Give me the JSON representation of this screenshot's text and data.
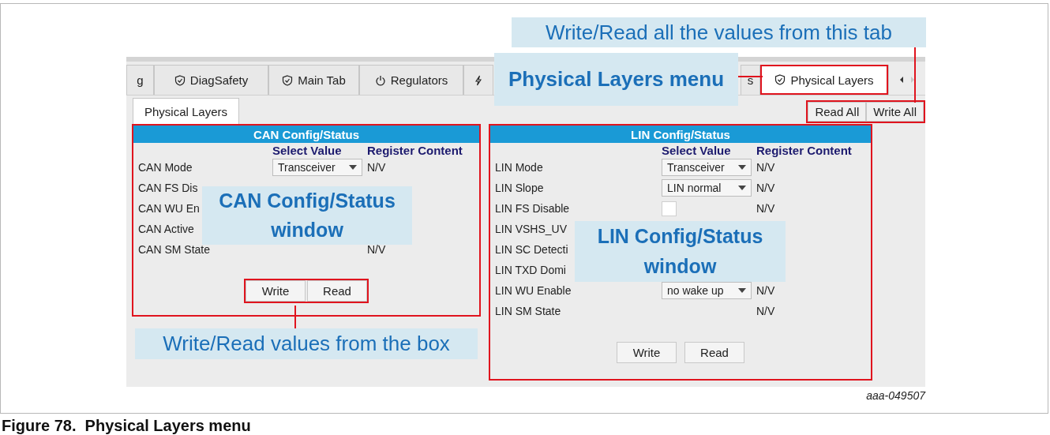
{
  "callouts": {
    "tab": "Write/Read all the values from this tab",
    "menu": "Physical Layers menu",
    "can": "CAN Config/Status window",
    "lin": "LIN Config/Status window",
    "box": "Write/Read values from the box"
  },
  "tabs": [
    {
      "label": "g",
      "selected": false
    },
    {
      "label": "DiagSafety",
      "selected": false
    },
    {
      "label": "Main Tab",
      "selected": false
    },
    {
      "label": "Regulators",
      "selected": false
    },
    {
      "selected": false
    },
    {
      "label": "s",
      "selected": false
    },
    {
      "label": "Physical Layers",
      "selected": true
    }
  ],
  "subtabs": [
    {
      "label": "Physical Layers"
    }
  ],
  "global_buttons": [
    "Read All",
    "Write All"
  ],
  "panels": [
    {
      "title": "CAN Config/Status",
      "columns": [
        "Select Value",
        "Register Content"
      ],
      "rows": [
        {
          "label": "CAN Mode",
          "kind": "select",
          "value": "Transceiver",
          "register": "N/V"
        },
        {
          "label": "CAN FS Dis",
          "kind": "none"
        },
        {
          "label": "CAN WU En",
          "kind": "none"
        },
        {
          "label": "CAN Active",
          "kind": "none"
        },
        {
          "label": "CAN SM State",
          "kind": "none",
          "register": "N/V"
        }
      ],
      "buttons": [
        "Write",
        "Read"
      ]
    },
    {
      "title": "LIN Config/Status",
      "columns": [
        "Select Value",
        "Register Content"
      ],
      "rows": [
        {
          "label": "LIN Mode",
          "kind": "select",
          "value": "Transceiver",
          "register": "N/V"
        },
        {
          "label": "LIN Slope",
          "kind": "select",
          "value": "LIN normal",
          "register": "N/V"
        },
        {
          "label": "LIN FS Disable",
          "kind": "checkbox",
          "checked": false,
          "register": "N/V"
        },
        {
          "label": "LIN VSHS_UV",
          "kind": "none"
        },
        {
          "label": "LIN SC Detecti",
          "kind": "none"
        },
        {
          "label": "LIN TXD Domi",
          "kind": "none"
        },
        {
          "label": "LIN WU Enable",
          "kind": "select",
          "value": "no wake up",
          "register": "N/V"
        },
        {
          "label": "LIN SM State",
          "kind": "none",
          "register": "N/V"
        }
      ],
      "buttons": [
        "Write",
        "Read"
      ]
    }
  ],
  "figure_id": "aaa-049507",
  "caption": "Figure 78.  Physical Layers menu"
}
